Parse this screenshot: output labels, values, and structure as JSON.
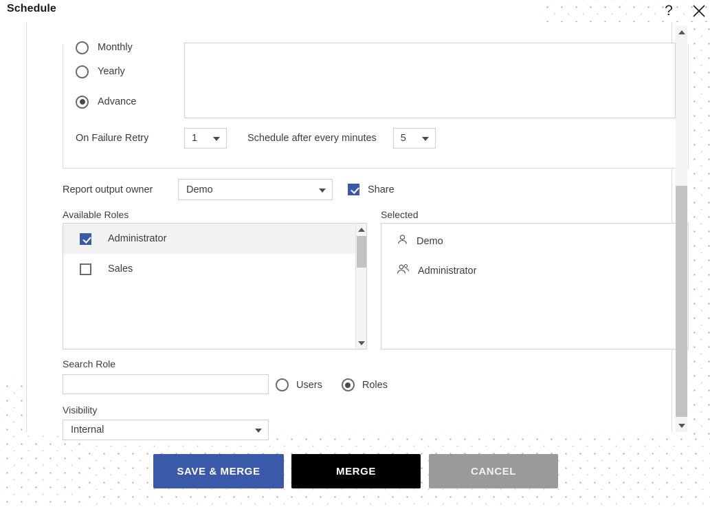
{
  "titlebar": {
    "title": "Schedule",
    "help_icon": "question-mark-icon",
    "close_icon": "close-icon"
  },
  "schedule_panel": {
    "frequency_options": [
      {
        "label": "Monthly",
        "checked": false
      },
      {
        "label": "Yearly",
        "checked": false
      },
      {
        "label": "Advance",
        "checked": true
      }
    ],
    "expression_value": "",
    "retry_label": "On Failure Retry",
    "retry_value": "1",
    "after_label": "Schedule after every minutes",
    "minutes_value": "5"
  },
  "owner": {
    "label": "Report output owner",
    "value": "Demo",
    "share_label": "Share",
    "share_checked": true
  },
  "available_roles": {
    "caption": "Available Roles",
    "rows": [
      {
        "label": "Administrator",
        "checked": true,
        "active": true
      },
      {
        "label": "Sales",
        "checked": false,
        "active": false
      }
    ]
  },
  "selected": {
    "caption": "Selected",
    "rows": [
      {
        "label": "Demo",
        "icon": "user-icon"
      },
      {
        "label": "Administrator",
        "icon": "users-group-icon"
      }
    ]
  },
  "search": {
    "caption": "Search Role",
    "value": "",
    "placeholder": "",
    "modes": [
      {
        "label": "Users",
        "checked": false
      },
      {
        "label": "Roles",
        "checked": true
      }
    ]
  },
  "visibility": {
    "caption": "Visibility",
    "value": "Internal"
  },
  "buttons": {
    "save_merge": "SAVE & MERGE",
    "merge": "MERGE",
    "cancel": "CANCEL"
  },
  "colors": {
    "accent_blue": "#3b59a9",
    "merge_black": "#000000",
    "cancel_gray": "#9a9a9a",
    "dot_pattern": "#9aa7d6"
  }
}
